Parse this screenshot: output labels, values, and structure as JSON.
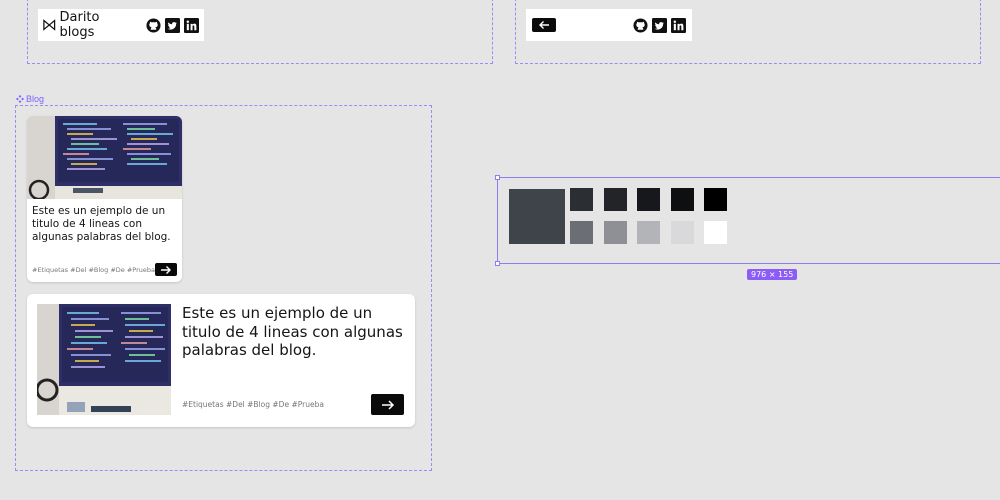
{
  "header_desktop": {
    "brand_name": "Darito blogs",
    "social_icons": [
      "github-icon",
      "twitter-icon",
      "linkedin-icon"
    ]
  },
  "header_mobile": {
    "back_icon": "arrow-left-icon",
    "social_icons": [
      "github-icon",
      "twitter-icon",
      "linkedin-icon"
    ]
  },
  "blog_frame": {
    "label": "Blog",
    "label_icon": "component-icon"
  },
  "card_small": {
    "title": "Este es un ejemplo de un titulo de 4 lineas con algunas palabras del blog.",
    "tags": "#Etiquetas #Del #Blog #De #Prueba",
    "button_icon": "arrow-right-icon"
  },
  "card_large": {
    "title": "Este es un ejemplo de un titulo de 4 lineas con algunas palabras del blog.",
    "tags": "#Etiquetas #Del #Blog #De #Prueba",
    "button_icon": "arrow-right-icon"
  },
  "palette": {
    "primary": "#3f444b",
    "dark_row": [
      "#2b2e33",
      "#222428",
      "#17181b",
      "#0e0f10",
      "#000000"
    ],
    "light_row": [
      "#6b6e74",
      "#8e9095",
      "#b3b4b7",
      "#d9d9dc",
      "#ffffff"
    ]
  },
  "selection": {
    "size_label": "976 × 155",
    "accent": "#8b5cf6"
  }
}
